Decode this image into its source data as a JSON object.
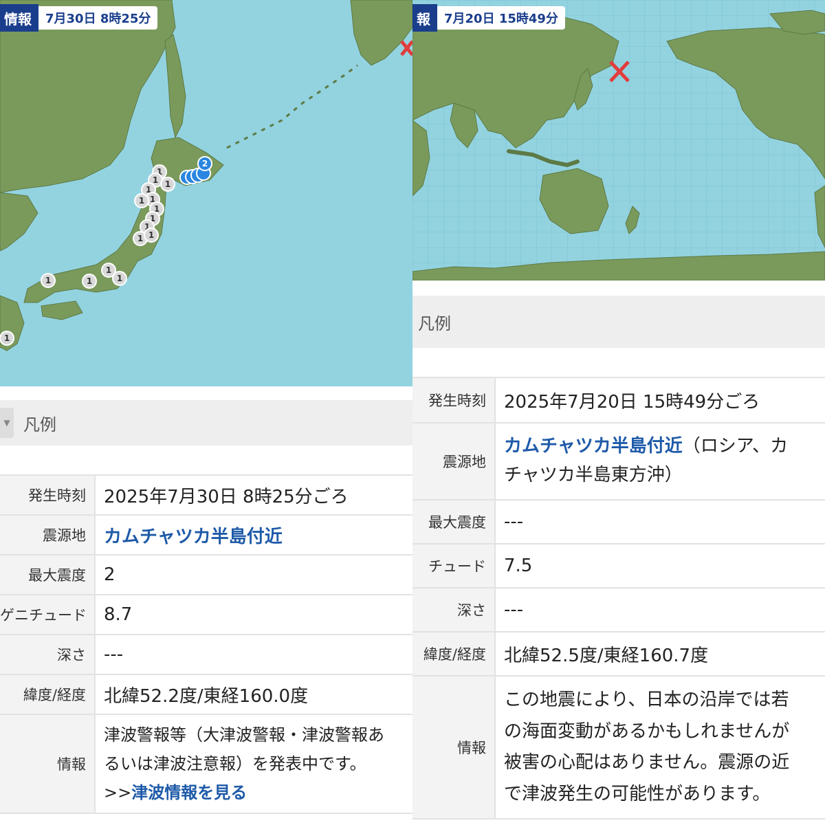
{
  "left": {
    "header": {
      "label": "情報",
      "time": "7月30日 8時25分"
    },
    "intensity_markers": [
      "2",
      "1",
      "1",
      "1",
      "1",
      "1",
      "1",
      "1",
      "1",
      "1",
      "1",
      "1",
      "1",
      "1",
      "1",
      "1",
      "1"
    ],
    "legend_label": "凡例",
    "table": {
      "occurrence_time": {
        "label": "発生時刻",
        "value": "2025年7月30日 8時25分ごろ"
      },
      "epicenter": {
        "label": "震源地",
        "value": "カムチャツカ半島付近"
      },
      "max_intensity": {
        "label": "最大震度",
        "value": "2"
      },
      "magnitude": {
        "label": "ゲニチュード",
        "value": "8.7"
      },
      "depth": {
        "label": "深さ",
        "value": "---"
      },
      "latlon": {
        "label": "緯度/経度",
        "value": "北緯52.2度/東経160.0度"
      },
      "info": {
        "label": "情報",
        "line1": "津波警報等（大津波警報・津波警報あ",
        "line2": "るいは津波注意報）を発表中です。",
        "link_prefix": ">>",
        "link_text": "津波情報を見る"
      }
    }
  },
  "right": {
    "header": {
      "label": "報",
      "time": "7月20日 15時49分"
    },
    "legend_label": "凡例",
    "table": {
      "occurrence_time": {
        "label": "発生時刻",
        "value": "2025年7月20日 15時49分ごろ"
      },
      "epicenter": {
        "label": "震源地",
        "link_text": "カムチャツカ半島付近",
        "rest1": "（ロシア、カ",
        "line2": "チャツカ半島東方沖）"
      },
      "max_intensity": {
        "label": "最大震度",
        "value": "---"
      },
      "magnitude": {
        "label": "チュード",
        "value": "7.5"
      },
      "depth": {
        "label": "深さ",
        "value": "---"
      },
      "latlon": {
        "label": "緯度/経度",
        "value": "北緯52.5度/東経160.7度"
      },
      "info": {
        "label": "情報",
        "line1": "この地震により、日本の沿岸では若",
        "line2": "の海面変動があるかもしれませんが",
        "line3": "被害の心配はありません。震源の近",
        "line4": "で津波発生の可能性があります。"
      }
    }
  },
  "colors": {
    "sea": "#93d3e0",
    "land": "#7a9a5c",
    "header_bg": "#1a3e8c",
    "link": "#1e5aa8",
    "marker_blue": "#2a86e0",
    "epicenter_x": "#e23c3c"
  }
}
